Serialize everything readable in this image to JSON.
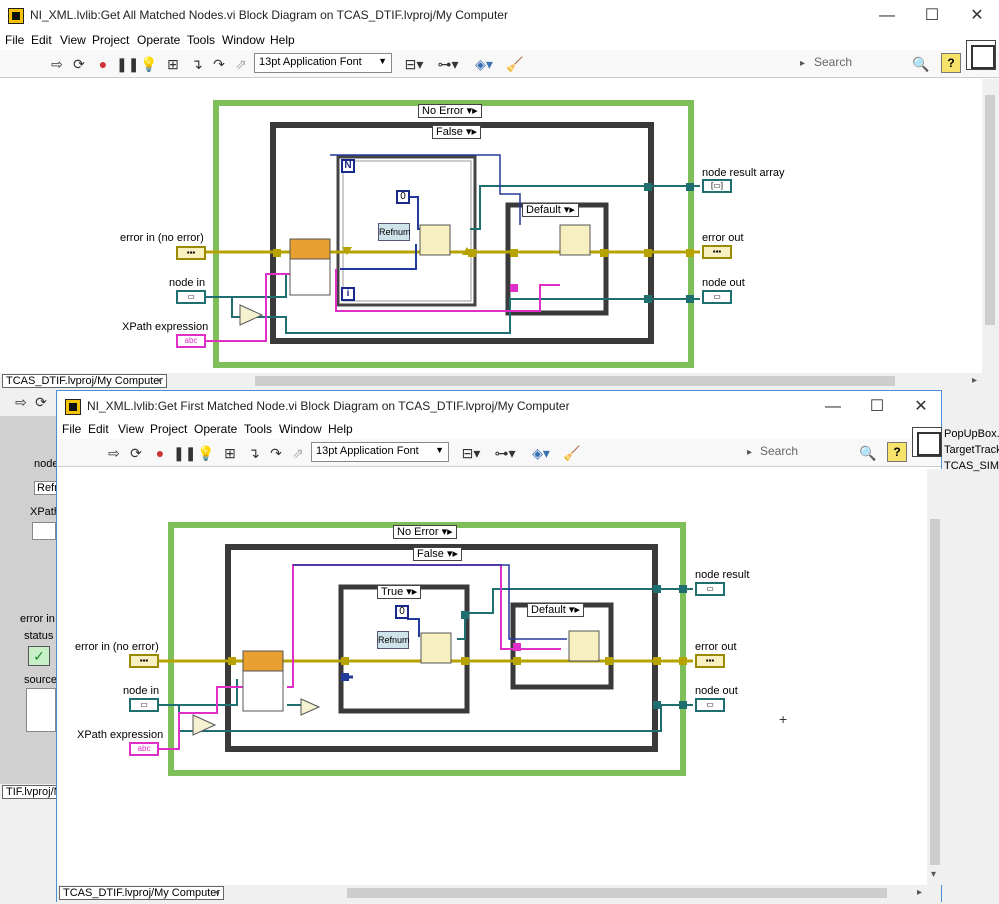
{
  "window1": {
    "title": "NI_XML.lvlib:Get All Matched Nodes.vi Block Diagram on TCAS_DTIF.lvproj/My Computer",
    "menu": [
      "File",
      "Edit",
      "View",
      "Project",
      "Operate",
      "Tools",
      "Window",
      "Help"
    ],
    "font_select": "13pt Application Font",
    "search_placeholder": "Search",
    "status_project": "TCAS_DTIF.lvproj/My Computer",
    "case_outer": "No Error",
    "case_inner": "False",
    "case_default": "Default",
    "loop_count": "N",
    "loop_index": "i",
    "refnum_label": "Refnum",
    "const_zero": "0",
    "inputs": [
      "error in (no error)",
      "node in",
      "XPath expression"
    ],
    "outputs": [
      "node result array",
      "error out",
      "node out"
    ]
  },
  "window2": {
    "title": "NI_XML.lvlib:Get First Matched Node.vi Block Diagram on TCAS_DTIF.lvproj/My Computer",
    "menu": [
      "File",
      "Edit",
      "View",
      "Project",
      "Operate",
      "Tools",
      "Window",
      "Help"
    ],
    "font_select": "13pt Application Font",
    "search_placeholder": "Search",
    "status_project": "TCAS_DTIF.lvproj/My Computer",
    "case_outer": "No Error",
    "case_inner": "False",
    "case_true": "True",
    "case_default": "Default",
    "refnum_label": "Refnum",
    "const_zero": "0",
    "inputs": [
      "error in (no error)",
      "node in",
      "XPath expression"
    ],
    "outputs": [
      "node result",
      "error out",
      "node out"
    ]
  },
  "background": {
    "left_labels": [
      "node",
      "Refnu",
      "XPath",
      "error in",
      "status",
      "source"
    ],
    "left_status_project": "TIF.lvproj/M",
    "right_items": [
      "PopUpBox.v",
      "TargetTrack",
      "TCAS_SIM_"
    ]
  },
  "colors": {
    "error_wire": "#b7a300",
    "refnum_wire": "#1f6f70",
    "string_wire": "#e02ec8",
    "index_wire": "#233a9c",
    "case_green": "#7fbf5a",
    "case_dark": "#3a3a3a"
  }
}
